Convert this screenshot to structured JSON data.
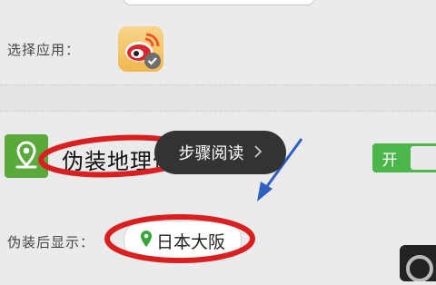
{
  "settings": {
    "select_app_label": "选择应用：",
    "fake_location_title": "伪装地理位置",
    "display_after_label": "伪装后显示：",
    "location_value": "日本大阪"
  },
  "toggle": {
    "label": "开",
    "state": "on"
  },
  "toast": {
    "text": "步骤阅读"
  },
  "icons": {
    "app": "weibo-app-icon",
    "location": "map-pin-icon",
    "chevron": "chevron-right-icon"
  },
  "colors": {
    "toggle_on": "#4cb64c",
    "pin_tile": "#59a93b",
    "annotation_ellipse": "#d91f1f",
    "annotation_arrow": "#2f5fbf",
    "toast_bg": "#333333"
  }
}
